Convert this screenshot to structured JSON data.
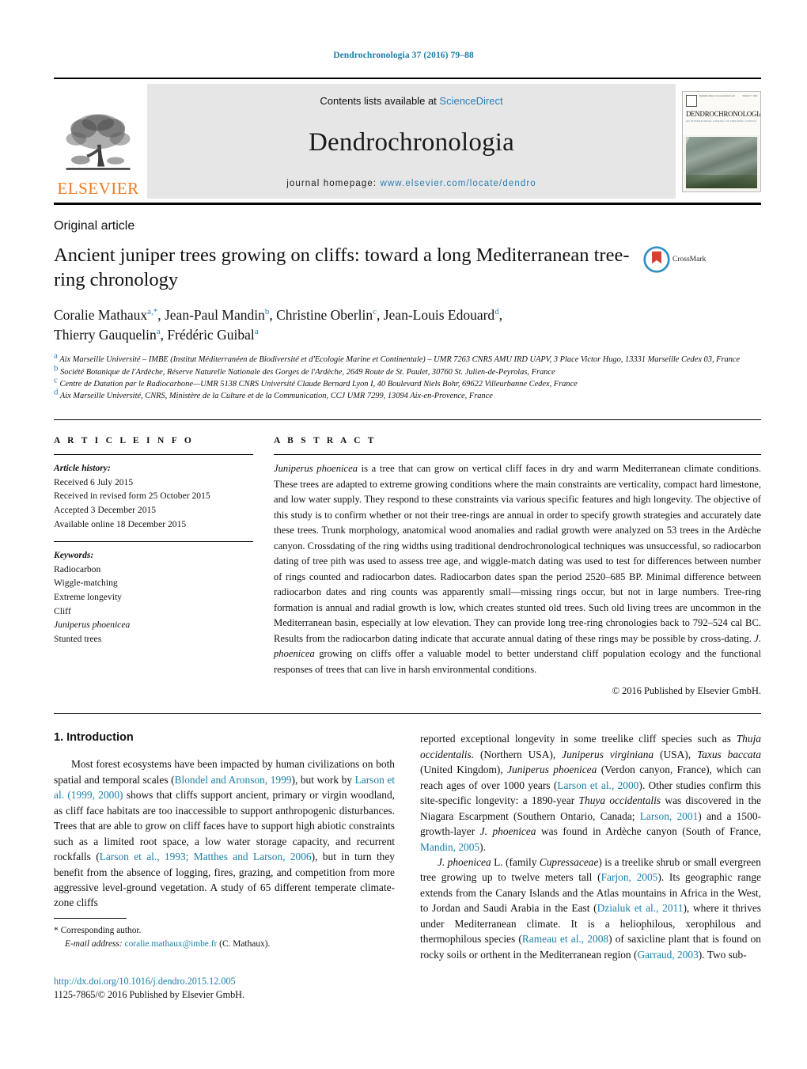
{
  "running_head": "Dendrochronologia 37 (2016) 79–88",
  "masthead": {
    "publisher_name": "ELSEVIER",
    "contents_prefix": "Contents lists available at ",
    "contents_link": "ScienceDirect",
    "journal_title": "Dendrochronologia",
    "homepage_prefix": "journal homepage: ",
    "homepage_url": "www.elsevier.com/locate/dendro",
    "cover": {
      "journal_name": "DENDROCHRONOLOGIA",
      "tagline": "AN INTERNATIONAL JOURNAL OF TREE-RING SCIENCE",
      "top_line": "Available online at www.sciencedirect.com",
      "volume_line": "Volume 37 · 2016"
    }
  },
  "article": {
    "type": "Original article",
    "title": "Ancient juniper trees growing on cliffs: toward a long Mediterranean tree-ring chronology",
    "crossmark_label": "CrossMark"
  },
  "authors": [
    {
      "name": "Coralie Mathaux",
      "marks": "a,*"
    },
    {
      "name": "Jean-Paul Mandin",
      "marks": "b"
    },
    {
      "name": "Christine Oberlin",
      "marks": "c"
    },
    {
      "name": "Jean-Louis Edouard",
      "marks": "d"
    },
    {
      "name": "Thierry Gauquelin",
      "marks": "a"
    },
    {
      "name": "Frédéric Guibal",
      "marks": "a"
    }
  ],
  "affiliations": [
    {
      "mark": "a",
      "text": "Aix Marseille Université – IMBE (Institut Méditerranéen de Biodiversité et d'Ecologie Marine et Continentale) – UMR 7263 CNRS AMU IRD UAPV, 3 Place Victor Hugo, 13331 Marseille Cedex 03, France"
    },
    {
      "mark": "b",
      "text": "Société Botanique de l'Ardèche, Réserve Naturelle Nationale des Gorges de l'Ardèche, 2649 Route de St. Paulet, 30760 St. Julien-de-Peyrolas, France"
    },
    {
      "mark": "c",
      "text": "Centre de Datation par le Radiocarbone—UMR 5138 CNRS Université Claude Bernard Lyon I, 40 Boulevard Niels Bohr, 69622 Villeurbanne Cedex, France"
    },
    {
      "mark": "d",
      "text": "Aix Marseille Université, CNRS, Ministère de la Culture et de la Communication, CCJ UMR 7299, 13094 Aix-en-Provence, France"
    }
  ],
  "article_info": {
    "heading": "A R T I C L E   I N F O",
    "history_label": "Article history:",
    "history": [
      "Received 6 July 2015",
      "Received in revised form 25 October 2015",
      "Accepted 3 December 2015",
      "Available online 18 December 2015"
    ],
    "keywords_label": "Keywords:",
    "keywords": [
      "Radiocarbon",
      "Wiggle-matching",
      "Extreme longevity",
      "Cliff",
      "Juniperus phoenicea",
      "Stunted trees"
    ],
    "italic_keywords": [
      "Juniperus phoenicea"
    ]
  },
  "abstract": {
    "heading": "A B S T R A C T",
    "text_parts": [
      {
        "style": "italic",
        "text": "Juniperus phoenicea"
      },
      {
        "style": "normal",
        "text": " is a tree that can grow on vertical cliff faces in dry and warm Mediterranean climate conditions. These trees are adapted to extreme growing conditions where the main constraints are verticality, compact hard limestone, and low water supply. They respond to these constraints via various specific features and high longevity. The objective of this study is to confirm whether or not their tree-rings are annual in order to specify growth strategies and accurately date these trees. Trunk morphology, anatomical wood anomalies and radial growth were analyzed on 53 trees in the Ardèche canyon. Crossdating of the ring widths using traditional dendrochronological techniques was unsuccessful, so radiocarbon dating of tree pith was used to assess tree age, and wiggle-match dating was used to test for differences between number of rings counted and radiocarbon dates. Radiocarbon dates span the period 2520–685 BP. Minimal difference between radiocarbon dates and ring counts was apparently small—missing rings occur, but not in large numbers. Tree-ring formation is annual and radial growth is low, which creates stunted old trees. Such old living trees are uncommon in the Mediterranean basin, especially at low elevation. They can provide long tree-ring chronologies back to 792–524 cal BC. Results from the radiocarbon dating indicate that accurate annual dating of these rings may be possible by cross-dating. "
      },
      {
        "style": "italic",
        "text": "J. phoenicea"
      },
      {
        "style": "normal",
        "text": " growing on cliffs offer a valuable model to better understand cliff population ecology and the functional responses of trees that can live in harsh environmental conditions."
      }
    ],
    "copyright": "© 2016 Published by Elsevier GmbH."
  },
  "body": {
    "section_title": "1.  Introduction",
    "left_paragraph_parts": [
      {
        "style": "normal",
        "text": "Most forest ecosystems have been impacted by human civilizations on both spatial and temporal scales ("
      },
      {
        "style": "ref",
        "text": "Blondel and Aronson, 1999"
      },
      {
        "style": "normal",
        "text": "), but work by "
      },
      {
        "style": "ref",
        "text": "Larson et al. (1999, 2000)"
      },
      {
        "style": "normal",
        "text": " shows that cliffs support ancient, primary or virgin woodland, as cliff face habitats are too inaccessible to support anthropogenic disturbances. Trees that are able to grow on cliff faces have to support high abiotic constraints such as a limited root space, a low water storage capacity, and recurrent rockfalls ("
      },
      {
        "style": "ref",
        "text": "Larson et al., 1993; Matthes and Larson, 2006"
      },
      {
        "style": "normal",
        "text": "), but in turn they benefit from the absence of logging, fires, grazing, and competition from more aggressive level-ground vegetation. A study of 65 different temperate climate-zone cliffs"
      }
    ],
    "right_paragraph1_parts": [
      {
        "style": "normal",
        "text": "reported exceptional longevity in some treelike cliff species such as "
      },
      {
        "style": "italic",
        "text": "Thuja occidentalis."
      },
      {
        "style": "normal",
        "text": " (Northern USA), "
      },
      {
        "style": "italic",
        "text": "Juniperus virginiana"
      },
      {
        "style": "normal",
        "text": " (USA), "
      },
      {
        "style": "italic",
        "text": "Taxus baccata"
      },
      {
        "style": "normal",
        "text": " (United Kingdom), "
      },
      {
        "style": "italic",
        "text": "Juniperus phoenicea"
      },
      {
        "style": "normal",
        "text": " (Verdon canyon, France), which can reach ages of over 1000 years ("
      },
      {
        "style": "ref",
        "text": "Larson et al., 2000"
      },
      {
        "style": "normal",
        "text": "). Other studies confirm this site-specific longevity: a 1890-year "
      },
      {
        "style": "italic",
        "text": "Thuya occidentalis"
      },
      {
        "style": "normal",
        "text": " was discovered in the Niagara Escarpment (Southern Ontario, Canada; "
      },
      {
        "style": "ref",
        "text": "Larson, 2001"
      },
      {
        "style": "normal",
        "text": ") and a 1500-growth-layer "
      },
      {
        "style": "italic",
        "text": "J. phoenicea"
      },
      {
        "style": "normal",
        "text": " was found in Ardèche canyon (South of France, "
      },
      {
        "style": "ref",
        "text": "Mandin, 2005"
      },
      {
        "style": "normal",
        "text": ")."
      }
    ],
    "right_paragraph2_parts": [
      {
        "style": "italic",
        "text": "J. phoenicea"
      },
      {
        "style": "normal",
        "text": " L. (family "
      },
      {
        "style": "italic",
        "text": "Cupressaceae"
      },
      {
        "style": "normal",
        "text": ") is a treelike shrub or small evergreen tree growing up to twelve meters tall ("
      },
      {
        "style": "ref",
        "text": "Farjon, 2005"
      },
      {
        "style": "normal",
        "text": "). Its geographic range extends from the Canary Islands and the Atlas mountains in Africa in the West, to Jordan and Saudi Arabia in the East ("
      },
      {
        "style": "ref",
        "text": "Dzialuk et al., 2011"
      },
      {
        "style": "normal",
        "text": "), where it thrives under Mediterranean climate. It is a heliophilous, xerophilous and thermophilous species ("
      },
      {
        "style": "ref",
        "text": "Rameau et al., 2008"
      },
      {
        "style": "normal",
        "text": ") of saxicline plant that is found on rocky soils or orthent in the Mediterranean region ("
      },
      {
        "style": "ref",
        "text": "Garraud, 2003"
      },
      {
        "style": "normal",
        "text": "). Two sub-"
      }
    ]
  },
  "footnote": {
    "corresponding_marker": "*",
    "corresponding_label": "Corresponding author.",
    "email_label": "E-mail address:",
    "email": "coralie.mathaux@imbe.fr",
    "email_suffix": "(C. Mathaux)."
  },
  "bottom": {
    "doi": "http://dx.doi.org/10.1016/j.dendro.2015.12.005",
    "issn_line": "1125-7865/© 2016 Published by Elsevier GmbH."
  },
  "colors": {
    "link_blue": "#1b7fa8",
    "elsevier_orange": "#f07c20",
    "band_gray": "#e6e6e6"
  }
}
